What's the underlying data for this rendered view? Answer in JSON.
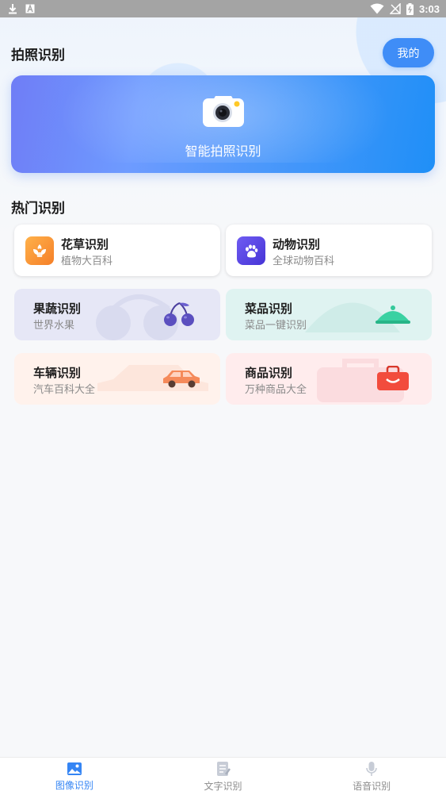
{
  "status_bar": {
    "time": "3:03",
    "icons": [
      "download-icon",
      "a-badge-icon",
      "wifi-icon",
      "signal-icon",
      "battery-icon"
    ]
  },
  "header": {
    "title": "拍照识别",
    "my_button": "我的"
  },
  "banner": {
    "label": "智能拍照识别",
    "icon": "camera-icon"
  },
  "hot": {
    "title": "热门识别",
    "cards": [
      {
        "title": "花草识别",
        "subtitle": "植物大百科",
        "icon": "flower-icon",
        "color": "#f7962f"
      },
      {
        "title": "动物识别",
        "subtitle": "全球动物百科",
        "icon": "paw-icon",
        "color": "#5a4be6"
      },
      {
        "title": "果蔬识别",
        "subtitle": "世界水果",
        "icon": "cherry-icon",
        "color": "#5b4fbf"
      },
      {
        "title": "菜品识别",
        "subtitle": "菜品一键识别",
        "icon": "dish-cover-icon",
        "color": "#2fc79a"
      },
      {
        "title": "车辆识别",
        "subtitle": "汽车百科大全",
        "icon": "car-icon",
        "color": "#f58a5a"
      },
      {
        "title": "商品识别",
        "subtitle": "万种商品大全",
        "icon": "bag-icon",
        "color": "#f24c3d"
      }
    ]
  },
  "tabs": [
    {
      "label": "图像识别",
      "icon": "image-icon",
      "active": true
    },
    {
      "label": "文字识别",
      "icon": "document-icon",
      "active": false
    },
    {
      "label": "语音识别",
      "icon": "microphone-icon",
      "active": false
    }
  ],
  "colors": {
    "accent": "#3f8df7",
    "active_tab": "#3585f4",
    "inactive_tab": "#8c8c8c"
  }
}
